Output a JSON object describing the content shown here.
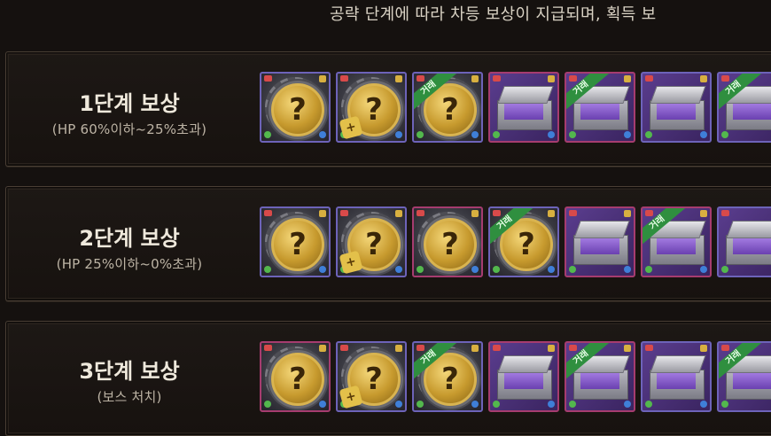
{
  "header": {
    "note": "공략 단계에 따라 차등 보상이 지급되며, 획득 보"
  },
  "rows": [
    {
      "title": "1단계 보상",
      "subtitle": "(HP 60%이하~25%초과)",
      "items": [
        {
          "kind": "mystery-coin",
          "border": "purple",
          "tradeable": false,
          "badge": ""
        },
        {
          "kind": "mystery-coin",
          "border": "purple",
          "tradeable": false,
          "badge": "+"
        },
        {
          "kind": "mystery-coin",
          "border": "purple",
          "tradeable": true,
          "badge": ""
        },
        {
          "kind": "chest",
          "border": "pink",
          "tradeable": false,
          "badge": ""
        },
        {
          "kind": "chest",
          "border": "pink",
          "tradeable": true,
          "badge": ""
        },
        {
          "kind": "chest",
          "border": "purple",
          "tradeable": false,
          "badge": ""
        },
        {
          "kind": "chest",
          "border": "purple",
          "tradeable": true,
          "badge": ""
        }
      ]
    },
    {
      "title": "2단계 보상",
      "subtitle": "(HP 25%이하~0%초과)",
      "items": [
        {
          "kind": "mystery-coin",
          "border": "purple",
          "tradeable": false,
          "badge": ""
        },
        {
          "kind": "mystery-coin",
          "border": "purple",
          "tradeable": false,
          "badge": "+"
        },
        {
          "kind": "mystery-coin",
          "border": "pink",
          "tradeable": false,
          "badge": ""
        },
        {
          "kind": "mystery-coin",
          "border": "purple",
          "tradeable": true,
          "badge": ""
        },
        {
          "kind": "chest",
          "border": "pink",
          "tradeable": false,
          "badge": ""
        },
        {
          "kind": "chest",
          "border": "pink",
          "tradeable": true,
          "badge": ""
        },
        {
          "kind": "chest",
          "border": "purple",
          "tradeable": false,
          "badge": ""
        }
      ]
    },
    {
      "title": "3단계 보상",
      "subtitle": "(보스 처치)",
      "items": [
        {
          "kind": "mystery-coin",
          "border": "pink",
          "tradeable": false,
          "badge": ""
        },
        {
          "kind": "mystery-coin",
          "border": "purple",
          "tradeable": false,
          "badge": "+"
        },
        {
          "kind": "mystery-coin",
          "border": "purple",
          "tradeable": true,
          "badge": ""
        },
        {
          "kind": "chest",
          "border": "pink",
          "tradeable": false,
          "badge": ""
        },
        {
          "kind": "chest",
          "border": "pink",
          "tradeable": true,
          "badge": ""
        },
        {
          "kind": "chest",
          "border": "purple",
          "tradeable": false,
          "badge": ""
        },
        {
          "kind": "chest",
          "border": "purple",
          "tradeable": true,
          "badge": ""
        }
      ]
    }
  ],
  "labels": {
    "mystery_glyph": "?",
    "trade_ribbon": "거래"
  },
  "colors": {
    "background": "#15110f",
    "border_purple": "#6d63b9",
    "border_pink": "#a63c6f",
    "ribbon_green": "#2f8f3f",
    "coin_gold": "#c79a2e"
  }
}
